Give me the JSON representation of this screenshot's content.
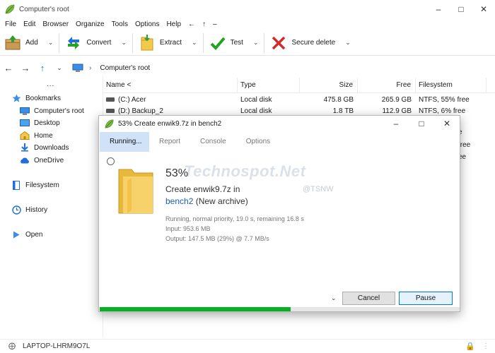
{
  "window": {
    "title": "Computer's root"
  },
  "menu": [
    "File",
    "Edit",
    "Browser",
    "Organize",
    "Tools",
    "Options",
    "Help",
    "←",
    "↑",
    "–"
  ],
  "toolbar": {
    "add": "Add",
    "convert": "Convert",
    "extract": "Extract",
    "test": "Test",
    "secure_delete": "Secure delete"
  },
  "address": {
    "crumb": "Computer's root"
  },
  "sidebar": {
    "dots": "...",
    "bookmarks": "Bookmarks",
    "items": [
      "Computer's root",
      "Desktop",
      "Home",
      "Downloads",
      "OneDrive"
    ],
    "filesystem": "Filesystem",
    "history": "History",
    "open": "Open"
  },
  "filelist": {
    "columns": [
      "Name <",
      "Type",
      "Size",
      "Free",
      "Filesystem"
    ],
    "rows": [
      {
        "name": "(C:) Acer",
        "type": "Local disk",
        "size": "475.8 GB",
        "free": "265.9 GB",
        "fs": "NTFS, 55% free"
      },
      {
        "name": "(D:) Backup_2",
        "type": "Local disk",
        "size": "1.8 TB",
        "free": "112.9 GB",
        "fs": "NTFS, 6% free"
      }
    ],
    "partial_fs": [
      "e",
      "free",
      "ee"
    ]
  },
  "status": {
    "host": "LAPTOP-LHRM9O7L"
  },
  "dialog": {
    "title": "53% Create enwik9.7z in bench2",
    "tabs": [
      "Running...",
      "Report",
      "Console",
      "Options"
    ],
    "percent": "53%",
    "create_line": "Create enwik9.7z in",
    "archive_link": "bench2",
    "archive_suffix": " (New archive)",
    "status_line": "Running, normal priority, 19.0 s, remaining 16.8 s",
    "input_line": "Input: 953.6 MB",
    "output_line": "Output: 147.5 MB (29%) @ 7.7 MB/s",
    "cancel": "Cancel",
    "pause": "Pause",
    "progress": 0.53
  },
  "watermark": {
    "main": "Technospot.Net",
    "sub": "@TSNW"
  },
  "colors": {
    "accent": "#1e6fd9",
    "progress": "#06b025",
    "tab_active": "#cfe2f8"
  }
}
